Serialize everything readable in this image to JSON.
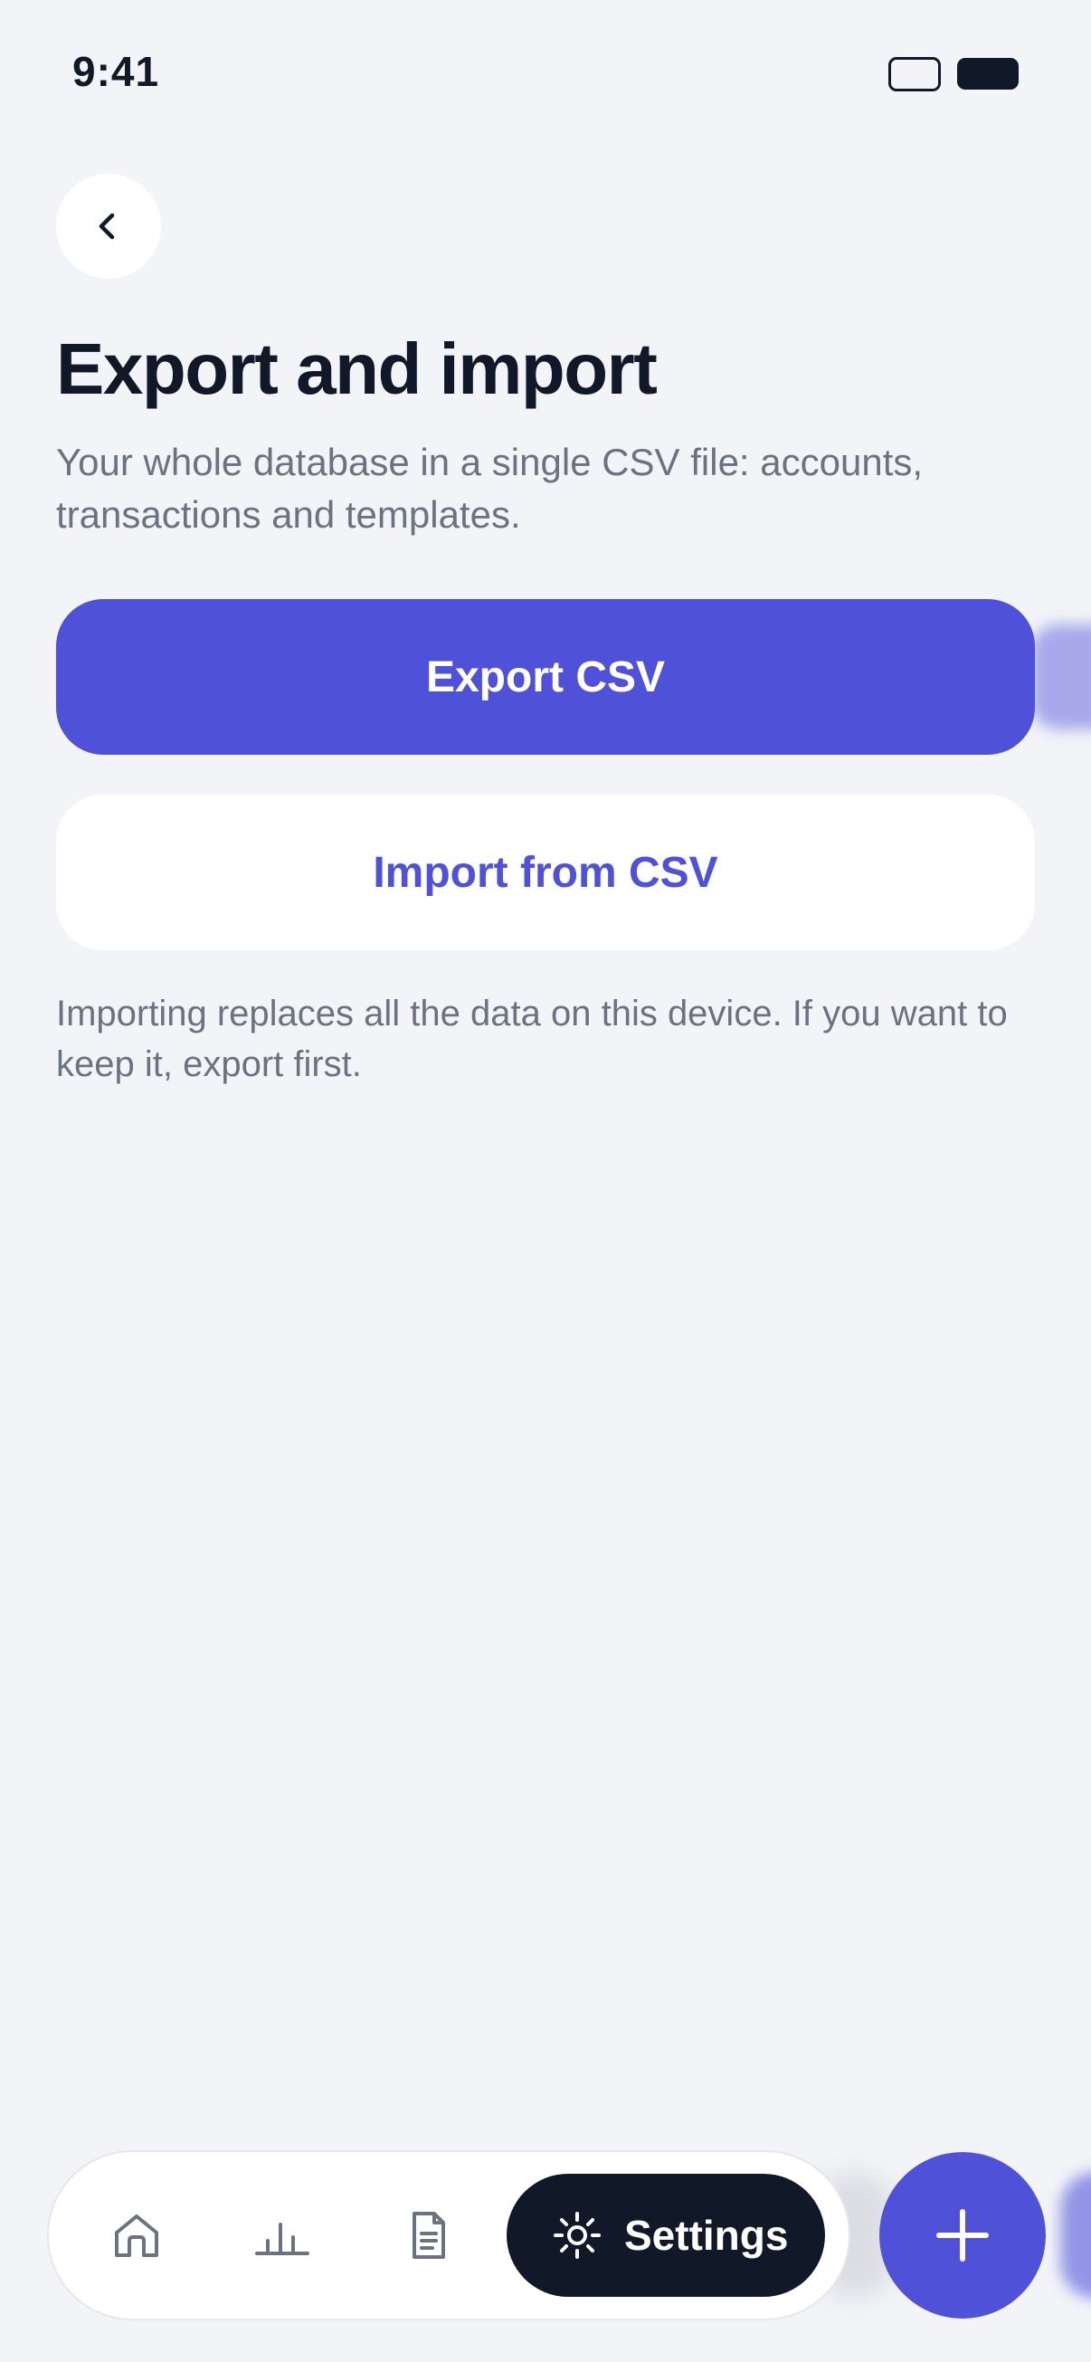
{
  "status_bar": {
    "time": "9:41"
  },
  "header": {
    "back_icon": "chevron-left-icon",
    "title": "Export and import",
    "subtitle": "Your whole database in a single CSV file: accounts, transactions and templates."
  },
  "actions": {
    "export_label": "Export CSV",
    "import_label": "Import from CSV"
  },
  "note": "Importing replaces all the data on this device. If you want to keep it, export first.",
  "bottom_nav": {
    "items": [
      {
        "icon": "home-icon"
      },
      {
        "icon": "bar-chart-icon"
      },
      {
        "icon": "document-icon"
      },
      {
        "icon": "gear-icon",
        "label": "Settings",
        "active": true
      }
    ],
    "fab_icon": "plus-icon"
  },
  "colors": {
    "accent": "#4f52d9",
    "background": "#f3f4f8",
    "dark": "#111827",
    "muted_text": "#6b7280"
  }
}
